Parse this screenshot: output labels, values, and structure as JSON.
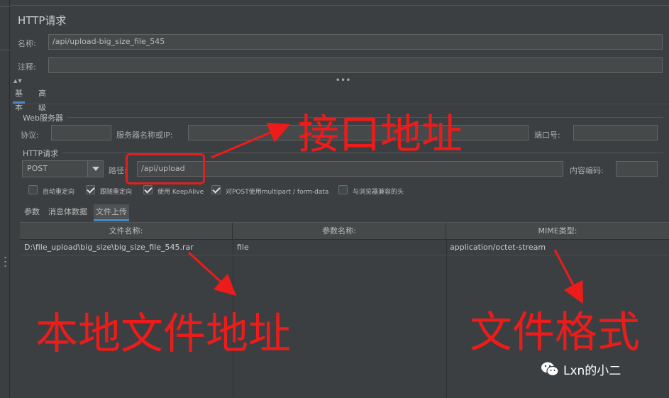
{
  "panel": {
    "title": "HTTP请求",
    "name_label": "名称:",
    "name_value": "/api/upload-big_size_file_545",
    "comment_label": "注释:",
    "comment_value": ""
  },
  "tabs": [
    {
      "label": "基本",
      "active": true
    },
    {
      "label": "高级",
      "active": false
    }
  ],
  "web_server": {
    "section_label": "Web服务器",
    "protocol_label": "协议:",
    "protocol_value": "",
    "server_label": "服务器名称或IP:",
    "server_value": "",
    "port_label": "端口号:",
    "port_value": ""
  },
  "http_request": {
    "section_label": "HTTP请求",
    "method": "POST",
    "path_label": "路径:",
    "path_value": "/api/upload",
    "encoding_label": "内容编码:",
    "encoding_value": ""
  },
  "options": [
    {
      "label": "自动重定向",
      "checked": false
    },
    {
      "label": "跟随重定向",
      "checked": true
    },
    {
      "label": "使用 KeepAlive",
      "checked": true
    },
    {
      "label": "对POST使用multipart / form-data",
      "checked": true
    },
    {
      "label": "与浏览器兼容的头",
      "checked": false
    }
  ],
  "subtabs": [
    {
      "label": "参数",
      "active": false
    },
    {
      "label": "消息体数据",
      "active": false
    },
    {
      "label": "文件上传",
      "active": true
    }
  ],
  "file_table": {
    "headers": [
      "文件名称:",
      "参数名称:",
      "MIME类型:"
    ],
    "rows": [
      [
        "D:\\file_upload\\big_size\\big_size_file_545.rar",
        "file",
        "application/octet-stream"
      ]
    ]
  },
  "annotations": {
    "api_address": "接口地址",
    "local_file_path": "本地文件地址",
    "file_format": "文件格式",
    "color": "#ee1b1b"
  },
  "watermark": {
    "text": "Lxn的小二",
    "icon": "wechat-icon"
  }
}
